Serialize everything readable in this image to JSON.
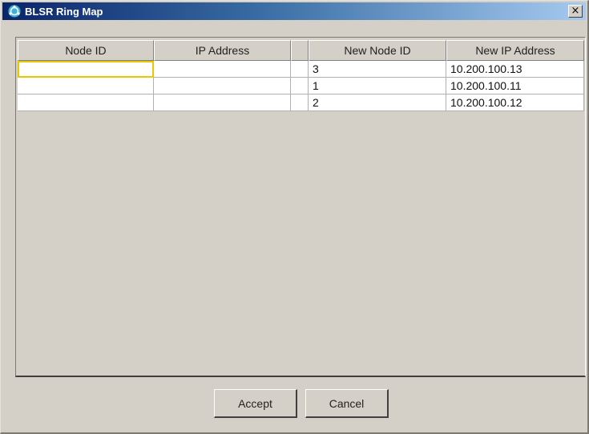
{
  "window": {
    "title": "BLSR Ring Map",
    "close_label": "×"
  },
  "table": {
    "columns": [
      "Node ID",
      "IP Address",
      "",
      "New Node ID",
      "New IP Address"
    ],
    "rows": [
      {
        "node_id": "",
        "ip_address": "",
        "new_node_id": "3",
        "new_ip_address": "10.200.100.13"
      },
      {
        "node_id": "",
        "ip_address": "",
        "new_node_id": "1",
        "new_ip_address": "10.200.100.11"
      },
      {
        "node_id": "",
        "ip_address": "",
        "new_node_id": "2",
        "new_ip_address": "10.200.100.12"
      }
    ]
  },
  "buttons": {
    "accept_label": "Accept",
    "cancel_label": "Cancel"
  },
  "colors": {
    "titlebar_start": "#0a246a",
    "titlebar_end": "#a6caf0",
    "dialog_bg": "#d4d0c8",
    "selected_cell_outline": "#e8c800"
  },
  "icons": {
    "app_icon": "blsr-ring-icon",
    "close_icon": "close-icon"
  }
}
